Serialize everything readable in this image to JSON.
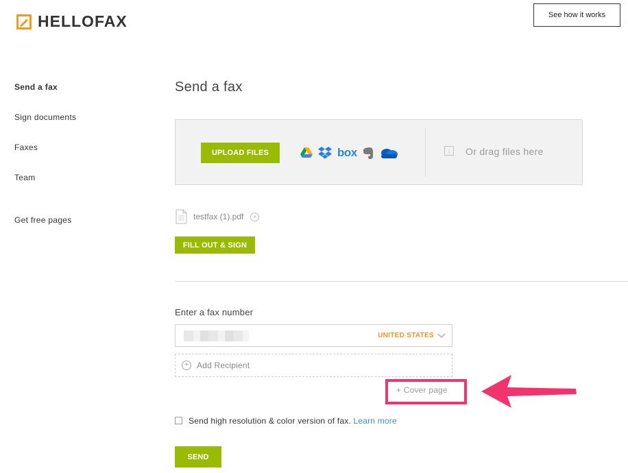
{
  "header": {
    "logo_text": "HELLOFAX",
    "how_it_works_label": "See how it works"
  },
  "sidebar": {
    "items": [
      {
        "label": "Send a fax",
        "active": true
      },
      {
        "label": "Sign documents"
      },
      {
        "label": "Faxes"
      },
      {
        "label": "Team"
      },
      {
        "label": "Get free pages"
      }
    ]
  },
  "main": {
    "title": "Send a fax",
    "upload": {
      "button_label": "UPLOAD FILES",
      "sources": [
        "google-drive-icon",
        "dropbox-icon",
        "box-icon",
        "evernote-icon",
        "onedrive-icon"
      ],
      "box_label": "box",
      "drag_text": "Or drag files here"
    },
    "file": {
      "name": "testfax (1).pdf"
    },
    "fill_sign_label": "FILL OUT & SIGN",
    "fax_number": {
      "label": "Enter a fax number",
      "value": "",
      "country": "UNITED STATES"
    },
    "add_recipient_label": "Add Recipient",
    "cover_page_label": "+ Cover page",
    "hires": {
      "label": "Send high resolution & color version of fax.",
      "link": "Learn more",
      "checked": false
    },
    "send_label": "SEND"
  },
  "colors": {
    "accent_green": "#99bb06",
    "logo_orange": "#f09a23",
    "country_orange": "#e8962a",
    "annotation_pink": "#f2336e",
    "link_blue": "#3a8cd8"
  }
}
